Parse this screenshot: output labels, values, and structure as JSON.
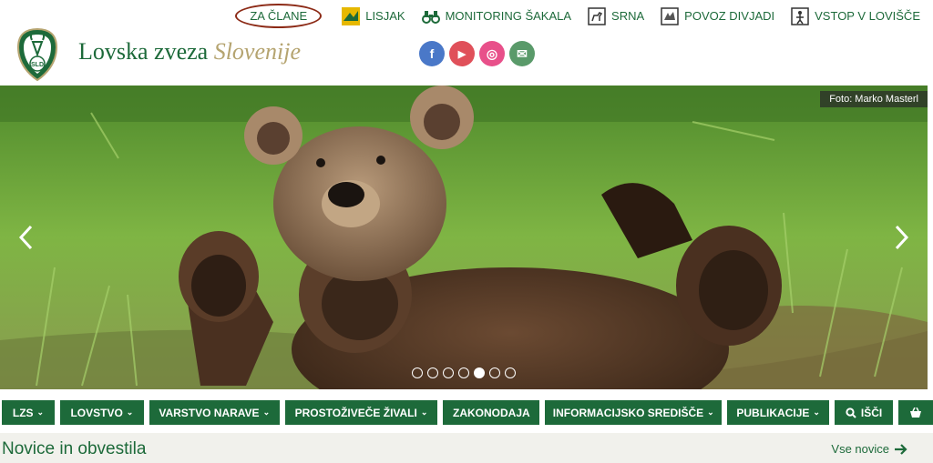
{
  "top_links": [
    {
      "label": "ZA ČLANE",
      "icon": "member-icon"
    },
    {
      "label": "LISJAK",
      "icon": "fox-icon"
    },
    {
      "label": "MONITORING ŠAKALA",
      "icon": "binoculars-icon"
    },
    {
      "label": "SRNA",
      "icon": "deer-sign-icon"
    },
    {
      "label": "POVOZ DIVJADI",
      "icon": "road-sign-icon"
    },
    {
      "label": "VSTOP V LOVIŠČE",
      "icon": "entry-sign-icon"
    }
  ],
  "brand": {
    "name_main": "Lovska zveza ",
    "name_italic": "Slovenije",
    "logo_text": "SLD"
  },
  "social": [
    {
      "name": "facebook",
      "glyph": "f",
      "color": "#4a78c8"
    },
    {
      "name": "youtube",
      "glyph": "▶",
      "color": "#e0505a"
    },
    {
      "name": "instagram",
      "glyph": "◎",
      "color": "#e8508a"
    },
    {
      "name": "email",
      "glyph": "✉",
      "color": "#5a9a6a"
    }
  ],
  "hero": {
    "credit": "Foto: Marko Masterl",
    "slide_count": 7,
    "active_slide": 5
  },
  "nav": [
    {
      "label": "LZS",
      "dropdown": true
    },
    {
      "label": "LOVSTVO",
      "dropdown": true
    },
    {
      "label": "VARSTVO NARAVE",
      "dropdown": true
    },
    {
      "label": "PROSTOŽIVEČE ŽIVALI",
      "dropdown": true
    },
    {
      "label": "ZAKONODAJA",
      "dropdown": false
    },
    {
      "label": "INFORMACIJSKO SREDIŠČE",
      "dropdown": true
    },
    {
      "label": "PUBLIKACIJE",
      "dropdown": true
    },
    {
      "label": "IŠČI",
      "dropdown": false,
      "icon": "search-icon"
    },
    {
      "label": "",
      "dropdown": false,
      "icon": "basket-icon"
    }
  ],
  "news": {
    "title": "Novice in obvestila",
    "all_link": "Vse novice"
  },
  "colors": {
    "brand_green": "#1d6a3a",
    "accent_gold": "#b5a470",
    "circle_red": "#8c2a16"
  }
}
